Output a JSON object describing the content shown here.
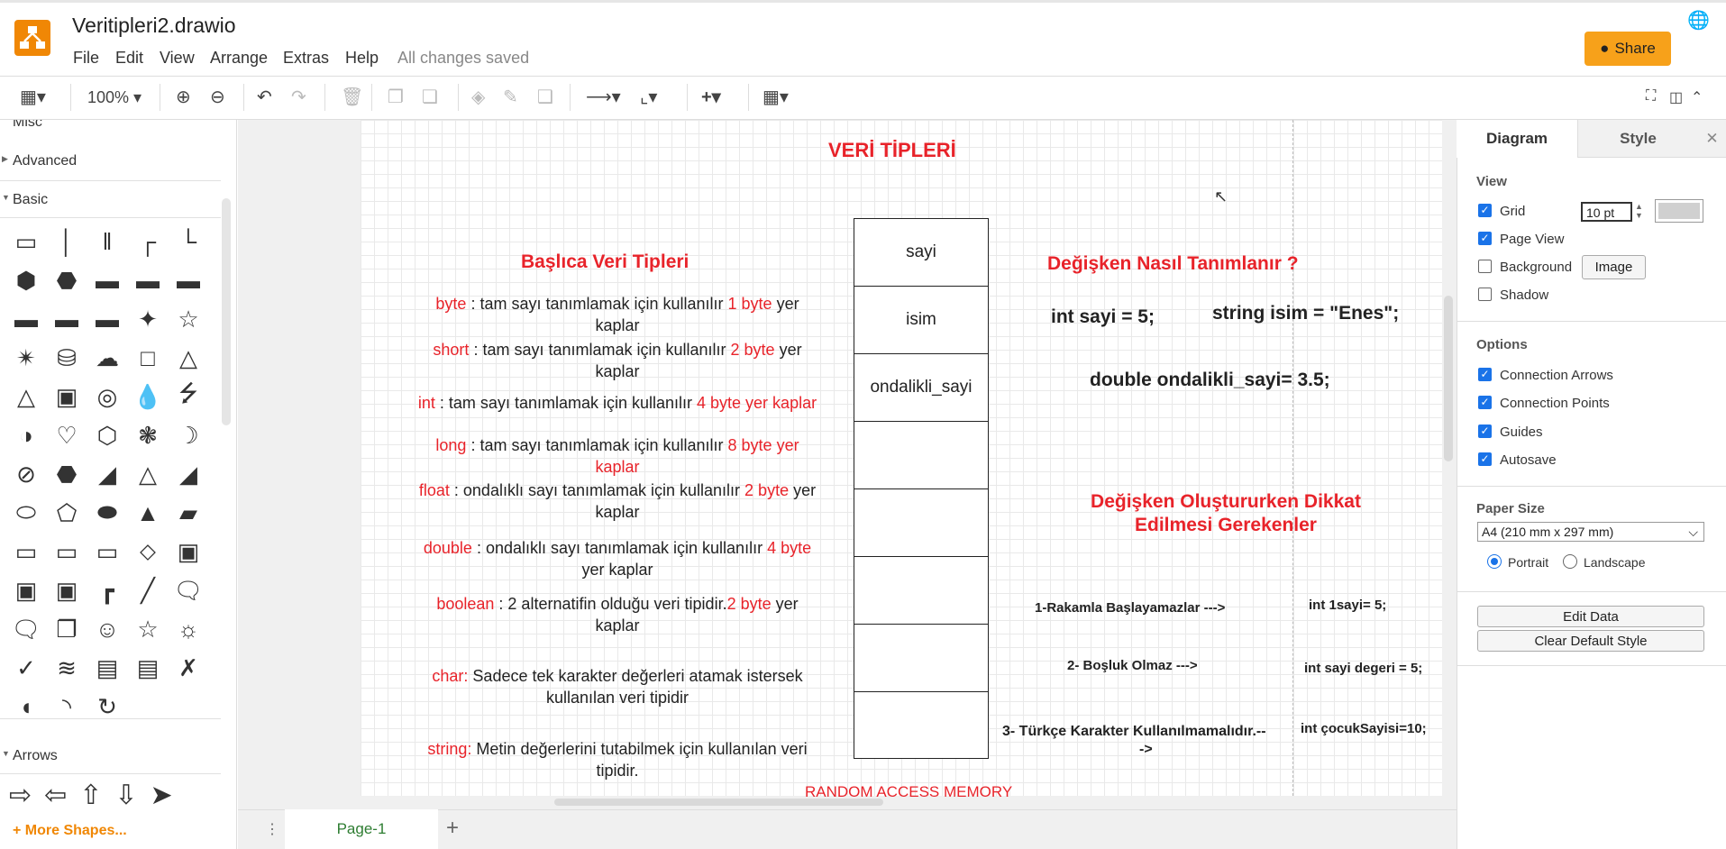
{
  "app": {
    "title": "Veritipleri2.drawio",
    "menu": [
      "File",
      "Edit",
      "View",
      "Arrange",
      "Extras",
      "Help"
    ],
    "status": "All changes saved",
    "share_label": "Share"
  },
  "toolbar": {
    "zoom": "100%"
  },
  "left_panel": {
    "sections": [
      "Misc",
      "Advanced",
      "Basic",
      "Arrows"
    ],
    "more_shapes": "+ More Shapes..."
  },
  "diagram": {
    "title": "VERİ TİPLERİ",
    "left_heading": "Başlıca Veri Tipleri",
    "types": [
      {
        "name": "byte",
        "line1": " : tam sayı tanımlamak için kullanılır ",
        "size": "1 byte",
        "line1b": " yer",
        "line2": "kaplar"
      },
      {
        "name": "short",
        "line1": " : tam sayı tanımlamak için kullanılır ",
        "size": "2 byte",
        "line1b": " yer",
        "line2": "kaplar"
      },
      {
        "name": "int",
        "line1": " : tam sayı tanımlamak için kullanılır ",
        "size": "4 byte yer kaplar",
        "line1b": "",
        "line2": ""
      },
      {
        "name": "long",
        "line1": " : tam sayı tanımlamak için kullanılır ",
        "size": "8 byte yer",
        "line1b": "",
        "line2": "kaplar"
      },
      {
        "name": "float",
        "line1": " : ondalıklı sayı tanımlamak için kullanılır ",
        "size": "2 byte",
        "line1b": " yer",
        "line2": "kaplar"
      },
      {
        "name": "double",
        "line1": " : ondalıklı sayı tanımlamak için kullanılır ",
        "size": "4 byte",
        "line1b": "",
        "line2": "yer kaplar"
      },
      {
        "name": "boolean",
        "line1": " : 2 alternatifin olduğu veri tipidir.",
        "size": "2 byte",
        "line1b": " yer",
        "line2": "kaplar"
      },
      {
        "name": "char:",
        "line1": " Sadece tek karakter değerleri atamak istersek",
        "size": "",
        "line1b": "",
        "line2": "kullanılan veri tipidir"
      },
      {
        "name": "string:",
        "line1": " Metin değerlerini tutabilmek için kullanılan veri",
        "size": "",
        "line1b": "",
        "line2": "tipidir."
      }
    ],
    "ram_cells": [
      "sayi",
      "isim",
      "ondalikli_sayi",
      "",
      "",
      "",
      "",
      ""
    ],
    "ram_label": "RANDOM ACCESS MEMORY",
    "right_heading": "Değişken Nasıl Tanımlanır ?",
    "code1": "int sayi = 5;",
    "code2": "string isim = \"Enes\";",
    "code3": "double ondalikli_sayi= 3.5;",
    "rules_heading_1": "Değişken Oluştururken Dikkat",
    "rules_heading_2": "Edilmesi Gerekenler",
    "rules": [
      {
        "rule": "1-Rakamla Başlayamazlar --->",
        "example": "int 1sayi= 5;"
      },
      {
        "rule": "2- Boşluk Olmaz --->",
        "example": "int sayi degeri = 5;"
      },
      {
        "rule": "3- Türkçe Karakter Kullanılmamalıdır.--",
        "rule2": "->",
        "example": "int çocukSayisi=10;"
      }
    ]
  },
  "page_tab": "Page-1",
  "right_panel": {
    "tabs": [
      "Diagram",
      "Style"
    ],
    "view_label": "View",
    "grid_label": "Grid",
    "grid_size": "10 pt",
    "page_view_label": "Page View",
    "background_label": "Background",
    "image_button": "Image",
    "shadow_label": "Shadow",
    "options_label": "Options",
    "options": [
      "Connection Arrows",
      "Connection Points",
      "Guides",
      "Autosave"
    ],
    "paper_size_label": "Paper Size",
    "paper_size": "A4 (210 mm x 297 mm)",
    "portrait": "Portrait",
    "landscape": "Landscape",
    "edit_data": "Edit Data",
    "clear_style": "Clear Default Style"
  }
}
